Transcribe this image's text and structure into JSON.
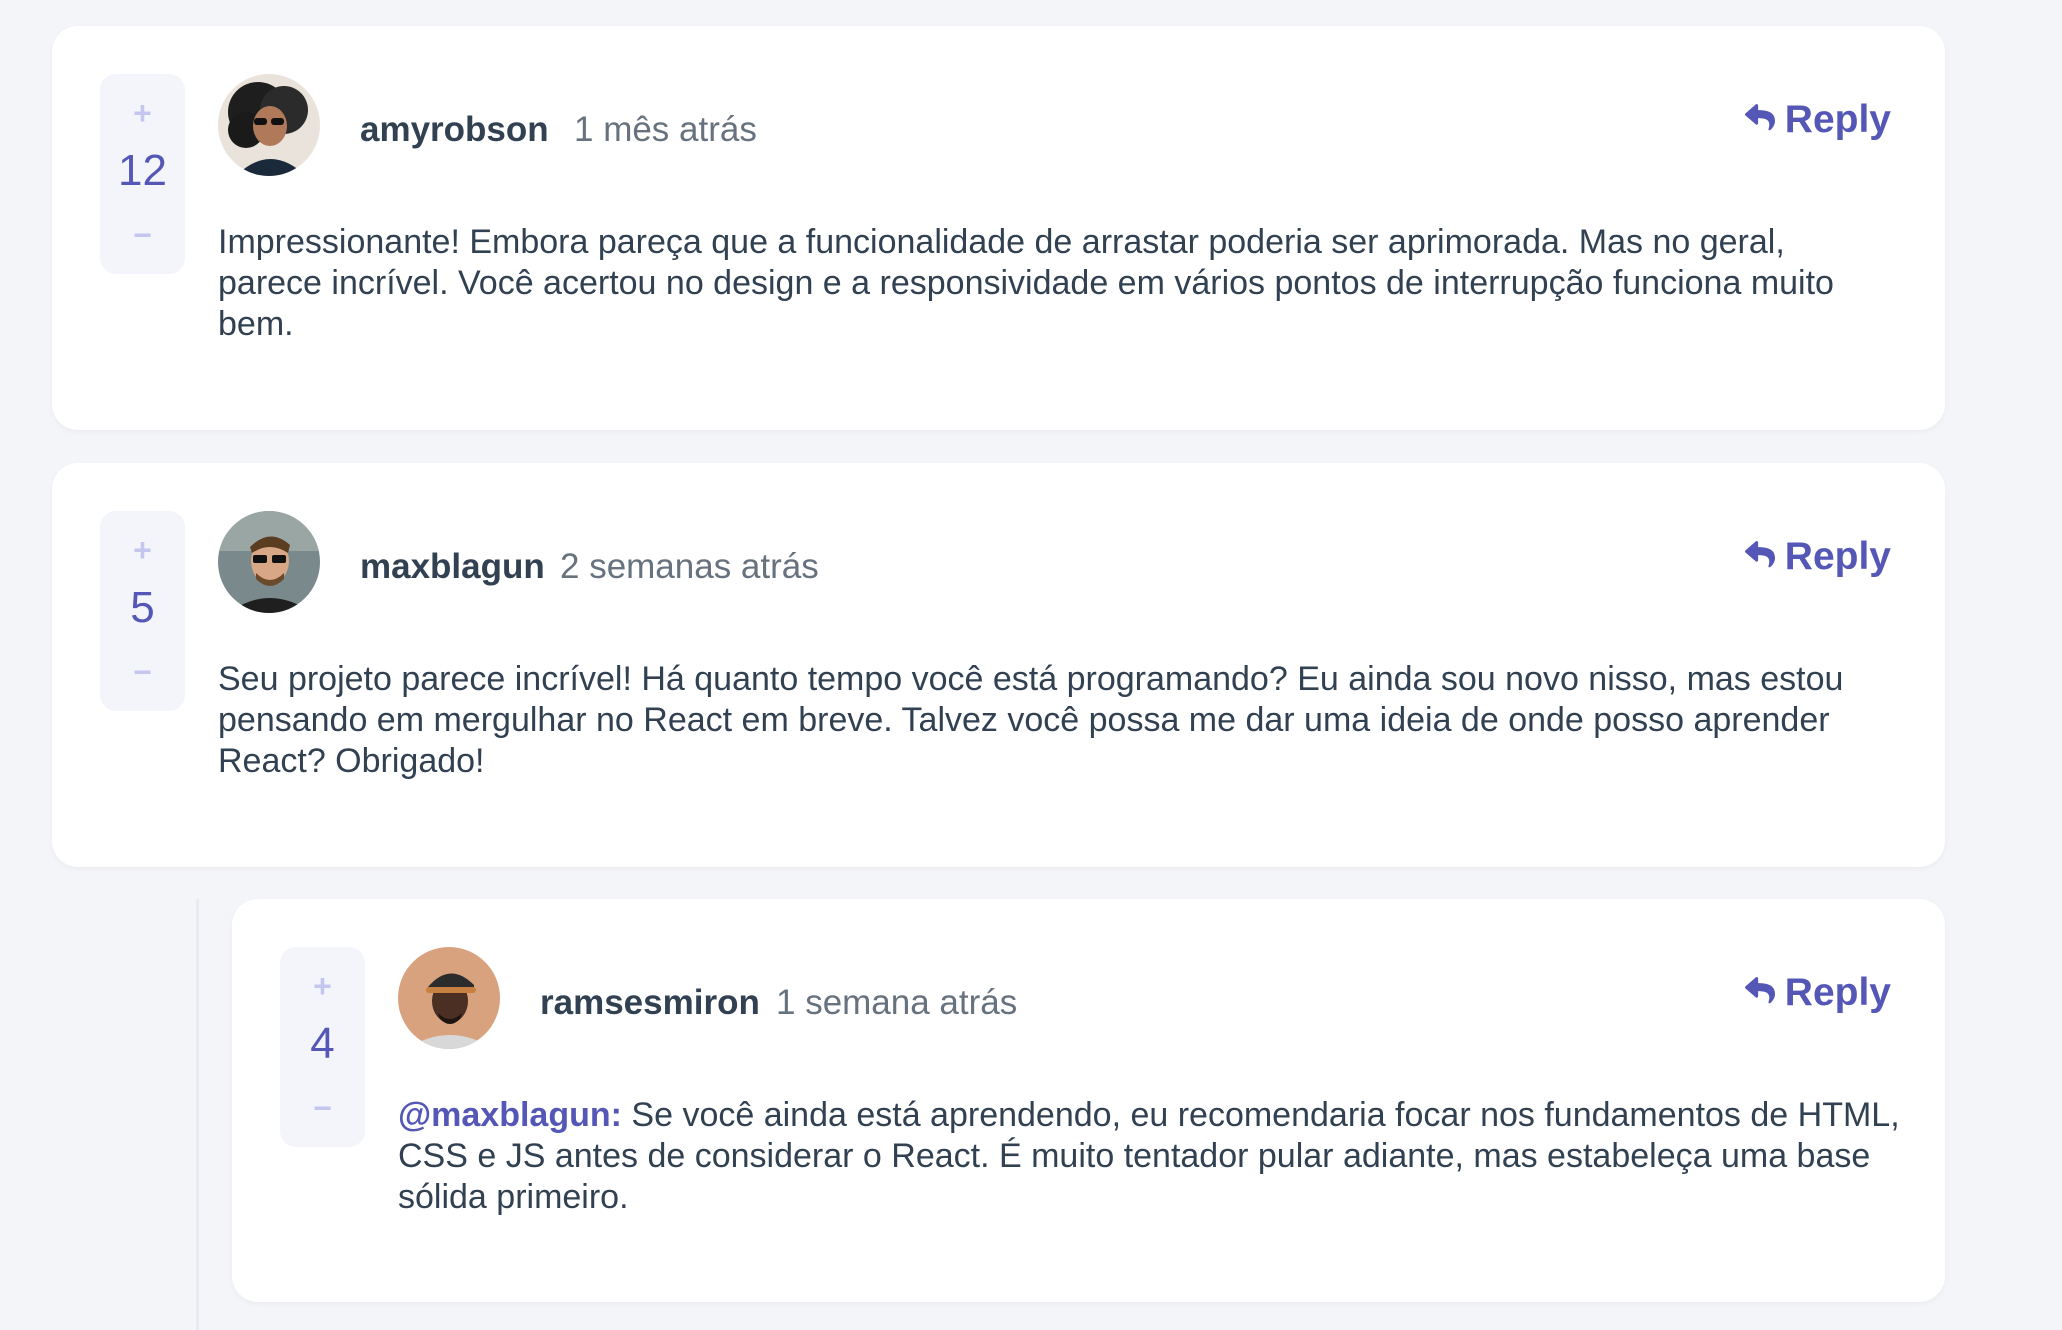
{
  "comments": [
    {
      "username": "amyrobson",
      "time": "1 mês atrás",
      "score": "12",
      "reply_label": "Reply",
      "content": "Impressionante! Embora pareça que a funcionalidade de arrastar poderia ser aprimorada. Mas no geral, parece incrível. Você acertou no design e a responsividade em vários pontos de interrupção funciona muito bem.",
      "vote_plus": "+",
      "vote_minus": "−"
    },
    {
      "username": "maxblagun",
      "time": "2 semanas atrás",
      "score": "5",
      "reply_label": "Reply",
      "content": "Seu projeto parece incrível! Há quanto tempo você está programando? Eu ainda sou novo nisso, mas estou pensando em mergulhar no React em breve. Talvez você possa me dar uma ideia de onde posso aprender React? Obrigado!",
      "vote_plus": "+",
      "vote_minus": "−"
    }
  ],
  "replies": [
    {
      "username": "ramsesmiron",
      "time": "1 semana atrás",
      "score": "4",
      "reply_label": "Reply",
      "mention": "@maxblagun:",
      "content": " Se você ainda está aprendendo, eu recomendaria focar nos fundamentos de HTML, CSS e JS antes de considerar o React. É muito tentador pular adiante, mas estabeleça uma base sólida primeiro.",
      "vote_plus": "+",
      "vote_minus": "−"
    }
  ],
  "colors": {
    "accent": "#5457b6",
    "accent_light": "#c4c6ef",
    "text": "#324152",
    "muted": "#67727e",
    "background": "#f4f5f9",
    "card": "#ffffff"
  },
  "icons": {
    "reply": "reply-arrow-icon"
  }
}
